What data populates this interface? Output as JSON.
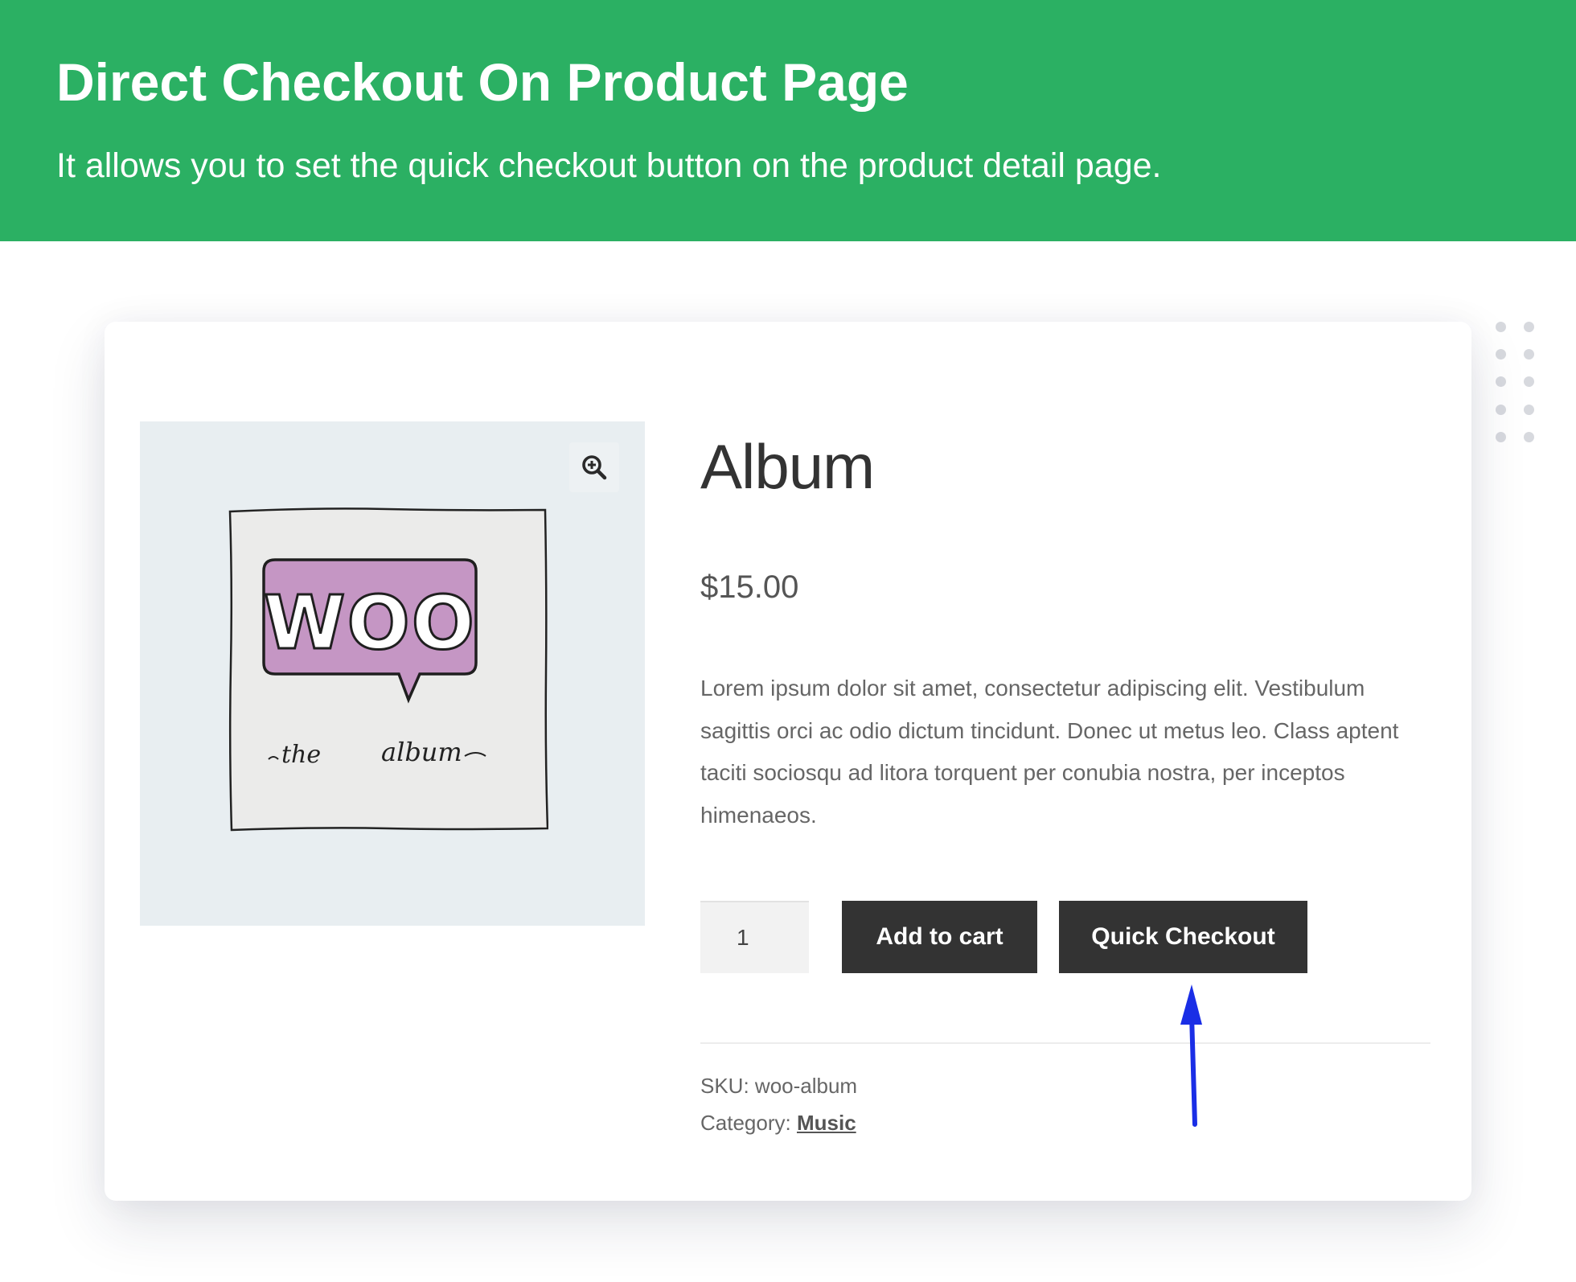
{
  "banner": {
    "title": "Direct Checkout On Product Page",
    "subtitle": "It allows you to set the quick checkout button on the product detail page.",
    "background_color": "#2bb063"
  },
  "product": {
    "image_text_main": "WOO",
    "image_text_the": "the",
    "image_text_album": "album",
    "zoom_icon": "zoom-in-icon",
    "title": "Album",
    "price": "$15.00",
    "description": "Lorem ipsum dolor sit amet, consectetur adipiscing elit. Vestibulum sagittis orci ac odio dictum tincidunt. Donec ut metus leo. Class aptent taciti sociosqu ad litora torquent per conubia nostra, per inceptos himenaeos.",
    "quantity": "1",
    "add_to_cart_label": "Add to cart",
    "quick_checkout_label": "Quick Checkout",
    "sku_label": "SKU:",
    "sku_value": "woo-album",
    "category_label": "Category:",
    "category_value": "Music"
  },
  "colors": {
    "button_bg": "#333333",
    "arrow": "#1a2ee6",
    "woo_purple": "#c596c4"
  }
}
